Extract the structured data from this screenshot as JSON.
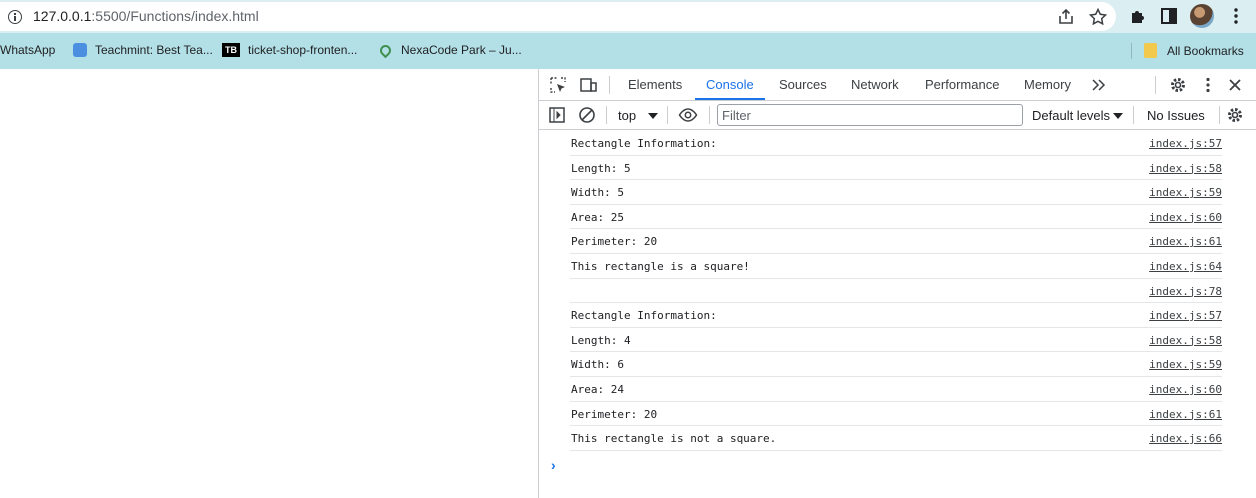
{
  "browser": {
    "url_host": "127.0.0.1",
    "url_rest": ":5500/Functions/index.html",
    "bookmarks": [
      {
        "label": "WhatsApp",
        "icon": "whatsapp-icon"
      },
      {
        "label": "Teachmint: Best Tea...",
        "icon": "teachmint-icon"
      },
      {
        "label": "ticket-shop-fronten...",
        "icon": "tb-logo-icon"
      },
      {
        "label": "NexaCode Park – Ju...",
        "icon": "leaf-icon"
      }
    ],
    "all_bookmarks": "All Bookmarks",
    "tb_logo": "TB"
  },
  "devtools": {
    "tabs": [
      "Elements",
      "Console",
      "Sources",
      "Network",
      "Performance",
      "Memory"
    ],
    "active_tab": "Console",
    "context": "top",
    "filter_placeholder": "Filter",
    "levels": "Default levels",
    "issues": "No Issues"
  },
  "console": {
    "messages": [
      {
        "text": "Rectangle Information:",
        "source": "index.js:57"
      },
      {
        "text": "Length: 5",
        "source": "index.js:58"
      },
      {
        "text": "Width: 5",
        "source": "index.js:59"
      },
      {
        "text": "Area: 25",
        "source": "index.js:60"
      },
      {
        "text": "Perimeter: 20",
        "source": "index.js:61"
      },
      {
        "text": "This rectangle is a square!",
        "source": "index.js:64"
      },
      {
        "text": "",
        "source": "index.js:78"
      },
      {
        "text": "Rectangle Information:",
        "source": "index.js:57"
      },
      {
        "text": "Length: 4",
        "source": "index.js:58"
      },
      {
        "text": "Width: 6",
        "source": "index.js:59"
      },
      {
        "text": "Area: 24",
        "source": "index.js:60"
      },
      {
        "text": "Perimeter: 20",
        "source": "index.js:61"
      },
      {
        "text": "This rectangle is not a square.",
        "source": "index.js:66"
      }
    ],
    "prompt": "›"
  }
}
